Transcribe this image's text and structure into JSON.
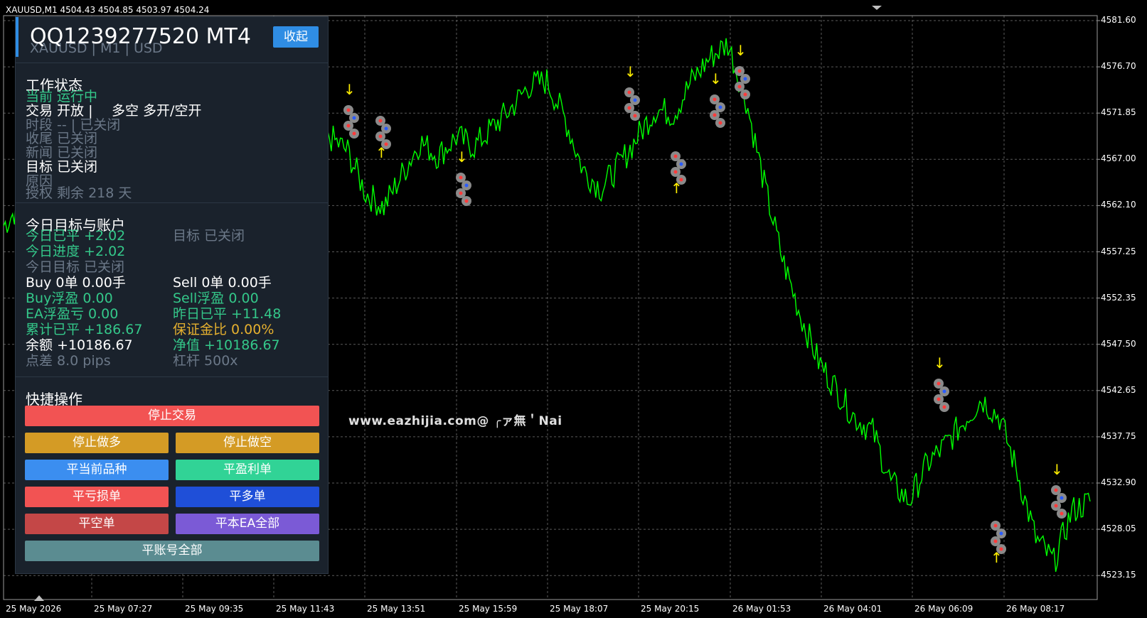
{
  "header": {
    "symbol_line": "XAUUSD,M1  4504.43 4504.85 4503.97 4504.24"
  },
  "watermark": "www.eazhijia.com@  ╭ァ無＇Nai",
  "price_axis": [
    "4581.60",
    "4576.70",
    "4571.85",
    "4567.00",
    "4562.10",
    "4557.25",
    "4552.35",
    "4547.50",
    "4542.65",
    "4537.75",
    "4532.90",
    "4528.05",
    "4523.15"
  ],
  "time_axis": [
    "25 May 2026",
    "25 May 07:27",
    "25 May 09:35",
    "25 May 11:43",
    "25 May 13:51",
    "25 May 15:59",
    "25 May 18:07",
    "25 May 20:15",
    "26 May 01:53",
    "26 May 04:01",
    "26 May 06:09",
    "26 May 08:17"
  ],
  "chart_data": {
    "type": "line",
    "symbol": "XAUUSD",
    "timeframe": "M1",
    "ohlc": {
      "open": 4504.43,
      "high": 4504.85,
      "low": 4503.97,
      "close": 4504.24
    },
    "ylim": [
      4520.5,
      4583.0
    ],
    "grid": true,
    "series_color": "#00ff00",
    "x": [
      0,
      2,
      4,
      6,
      8,
      10,
      12,
      14,
      16,
      18,
      20,
      22,
      24,
      26,
      28,
      30,
      32,
      34,
      36,
      38,
      40,
      42,
      44,
      46,
      48,
      50,
      52,
      54,
      56,
      58,
      60,
      62,
      64,
      66,
      68,
      70,
      72,
      74,
      76,
      78,
      80,
      82,
      84,
      86,
      88,
      90,
      92,
      94,
      96,
      98,
      100,
      102,
      104,
      106,
      108,
      110,
      112,
      114,
      116,
      118,
      120
    ],
    "values": [
      4560.5,
      4563.0,
      4566.8,
      4569.5,
      4572.0,
      4574.2,
      4575.6,
      4573.0,
      4570.0,
      4571.5,
      4574.5,
      4576.3,
      4572.0,
      4566.0,
      4558.0,
      4554.5,
      4561.0,
      4566.0,
      4570.0,
      4568.5,
      4564.0,
      4562.5,
      4566.0,
      4569.5,
      4568.0,
      4570.0,
      4569.0,
      4571.0,
      4573.0,
      4575.5,
      4576.0,
      4572.0,
      4566.5,
      4564.5,
      4567.0,
      4570.0,
      4573.0,
      4572.5,
      4576.0,
      4578.5,
      4580.0,
      4574.0,
      4565.0,
      4557.0,
      4551.0,
      4546.0,
      4543.0,
      4540.0,
      4538.5,
      4533.0,
      4531.0,
      4535.0,
      4537.0,
      4539.5,
      4542.0,
      4540.0,
      4534.0,
      4527.0,
      4524.5,
      4530.0,
      4531.0
    ]
  },
  "panel": {
    "title": "QQ1239277520 MT4",
    "subtitle": "XAUUSD  |  M1  |  USD",
    "collapse_label": "收起",
    "work_status": {
      "title": "工作状态",
      "current": "当前  运行中",
      "trade_a": "交易  开放  |",
      "trade_b": "多空  多开/空开",
      "session": "时段  --  |  已关闭",
      "close_end": "收尾  已关闭",
      "news": "新闻  已关闭",
      "target": "目标  已关闭",
      "reason": "原因",
      "license": "授权  剩余 218 天"
    },
    "today": {
      "title": "今日目标与账户",
      "closed_today": "今日已平  +2.02",
      "target_closed": "目标  已关闭",
      "progress": "今日进度  +2.02",
      "today_target": "今日目标  已关闭",
      "buy": "Buy  0单  0.00手",
      "sell": "Sell  0单  0.00手",
      "buy_float": "Buy浮盈  0.00",
      "sell_float": "Sell浮盈  0.00",
      "ea_float": "EA浮盈亏  0.00",
      "yesterday": "昨日已平  +11.48",
      "total_closed": "累计已平  +186.67",
      "margin_ratio": "保证金比  0.00%",
      "balance": "余额  +10186.67",
      "equity": "净值  +10186.67",
      "spread": "点差  8.0 pips",
      "leverage": "杠杆  500x"
    },
    "quick": {
      "title": "快捷操作",
      "stop_trading": "停止交易",
      "stop_long": "停止做多",
      "stop_short": "停止做空",
      "close_symbol": "平当前品种",
      "close_profit": "平盈利单",
      "close_loss": "平亏损单",
      "close_long": "平多单",
      "close_short": "平空单",
      "close_ea_all": "平本EA全部",
      "close_account_all": "平账号全部"
    },
    "colors": {
      "red": "#f25353",
      "gold": "#d49b25",
      "blue": "#3b8ef0",
      "teal": "#31d396",
      "navy": "#1f4fd8",
      "darkred": "#c44747",
      "purple": "#7b5ad6",
      "slate": "#5b8c91"
    }
  }
}
